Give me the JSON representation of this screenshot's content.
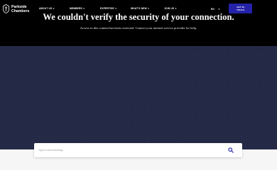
{
  "brand": {
    "line1": "Parkside",
    "line2": "Chambers"
  },
  "nav": {
    "items": [
      {
        "label": "ABOUT US"
      },
      {
        "label": "MEMBERS"
      },
      {
        "label": "EXPERTISE"
      },
      {
        "label": "WHAT'S NEW"
      },
      {
        "label": "JOIN US"
      }
    ],
    "language": "EN",
    "cta_label": "GET IN TOUCH"
  },
  "notice": {
    "headline": "We couldn't verify the security of your connection.",
    "message": "Access to this content has been restricted. Contact your internet service provider for help."
  },
  "search": {
    "placeholder": "Type to start searching...",
    "value": ""
  },
  "colors": {
    "header_bg": "#000000",
    "hero_bg": "#232845",
    "accent": "#2422a8",
    "search_icon": "#2a2aa8"
  }
}
